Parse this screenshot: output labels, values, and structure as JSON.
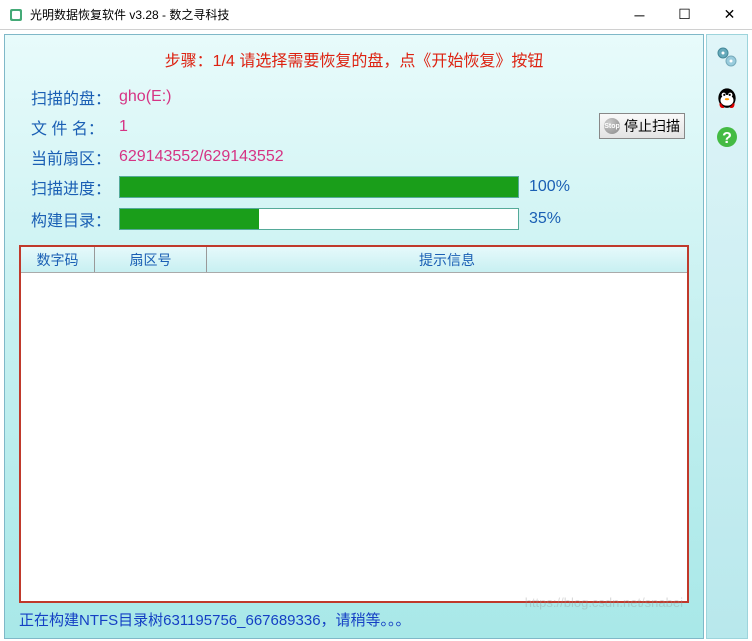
{
  "titlebar": {
    "title": "光明数据恢复软件 v3.28 - 数之寻科技"
  },
  "step": {
    "text": "步骤：1/4 请选择需要恢复的盘，点《开始恢复》按钮"
  },
  "info": {
    "disk_label": "扫描的盘：",
    "disk_value": "gho(E:)",
    "filename_label": "文 件 名：",
    "filename_value": "1",
    "sector_label": "当前扇区：",
    "sector_value": "629143552/629143552"
  },
  "progress": {
    "scan_label": "扫描进度：",
    "scan_pct": "100%",
    "scan_width": "100%",
    "build_label": "构建目录：",
    "build_pct": "35%",
    "build_width": "35%"
  },
  "buttons": {
    "stop_label": "停止扫描"
  },
  "table": {
    "col1": "数字码",
    "col2": "扇区号",
    "col3": "提示信息"
  },
  "status": {
    "text": "正在构建NTFS目录树631195756_667689336，请稍等。。。"
  },
  "watermark": "https://blog.csdn.net/snabei"
}
